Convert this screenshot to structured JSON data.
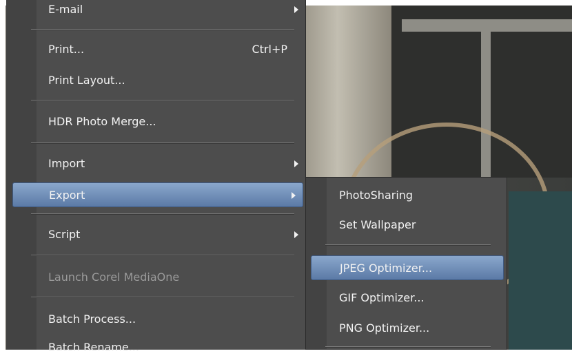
{
  "file_menu": {
    "items": [
      {
        "label": "E-mail",
        "submenu": true
      },
      {
        "label": "Print...",
        "shortcut": "Ctrl+P"
      },
      {
        "label": "Print Layout..."
      },
      {
        "label": "HDR Photo Merge..."
      },
      {
        "label": "Import",
        "submenu": true
      },
      {
        "label": "Export",
        "submenu": true,
        "highlighted": true
      },
      {
        "label": "Script",
        "submenu": true
      },
      {
        "label": "Launch Corel MediaOne",
        "disabled": true
      },
      {
        "label": "Batch Process..."
      },
      {
        "label": "Batch Rename..."
      }
    ]
  },
  "export_submenu": {
    "items": [
      {
        "label": "PhotoSharing"
      },
      {
        "label": "Set Wallpaper"
      },
      {
        "label": "JPEG Optimizer...",
        "highlighted": true
      },
      {
        "label": "GIF Optimizer..."
      },
      {
        "label": "PNG Optimizer..."
      }
    ]
  },
  "colors": {
    "menu_bg": "#4d4d4d",
    "highlight": "#6e8db8",
    "text": "#f2f2f2",
    "disabled_text": "#9a9a9a"
  }
}
